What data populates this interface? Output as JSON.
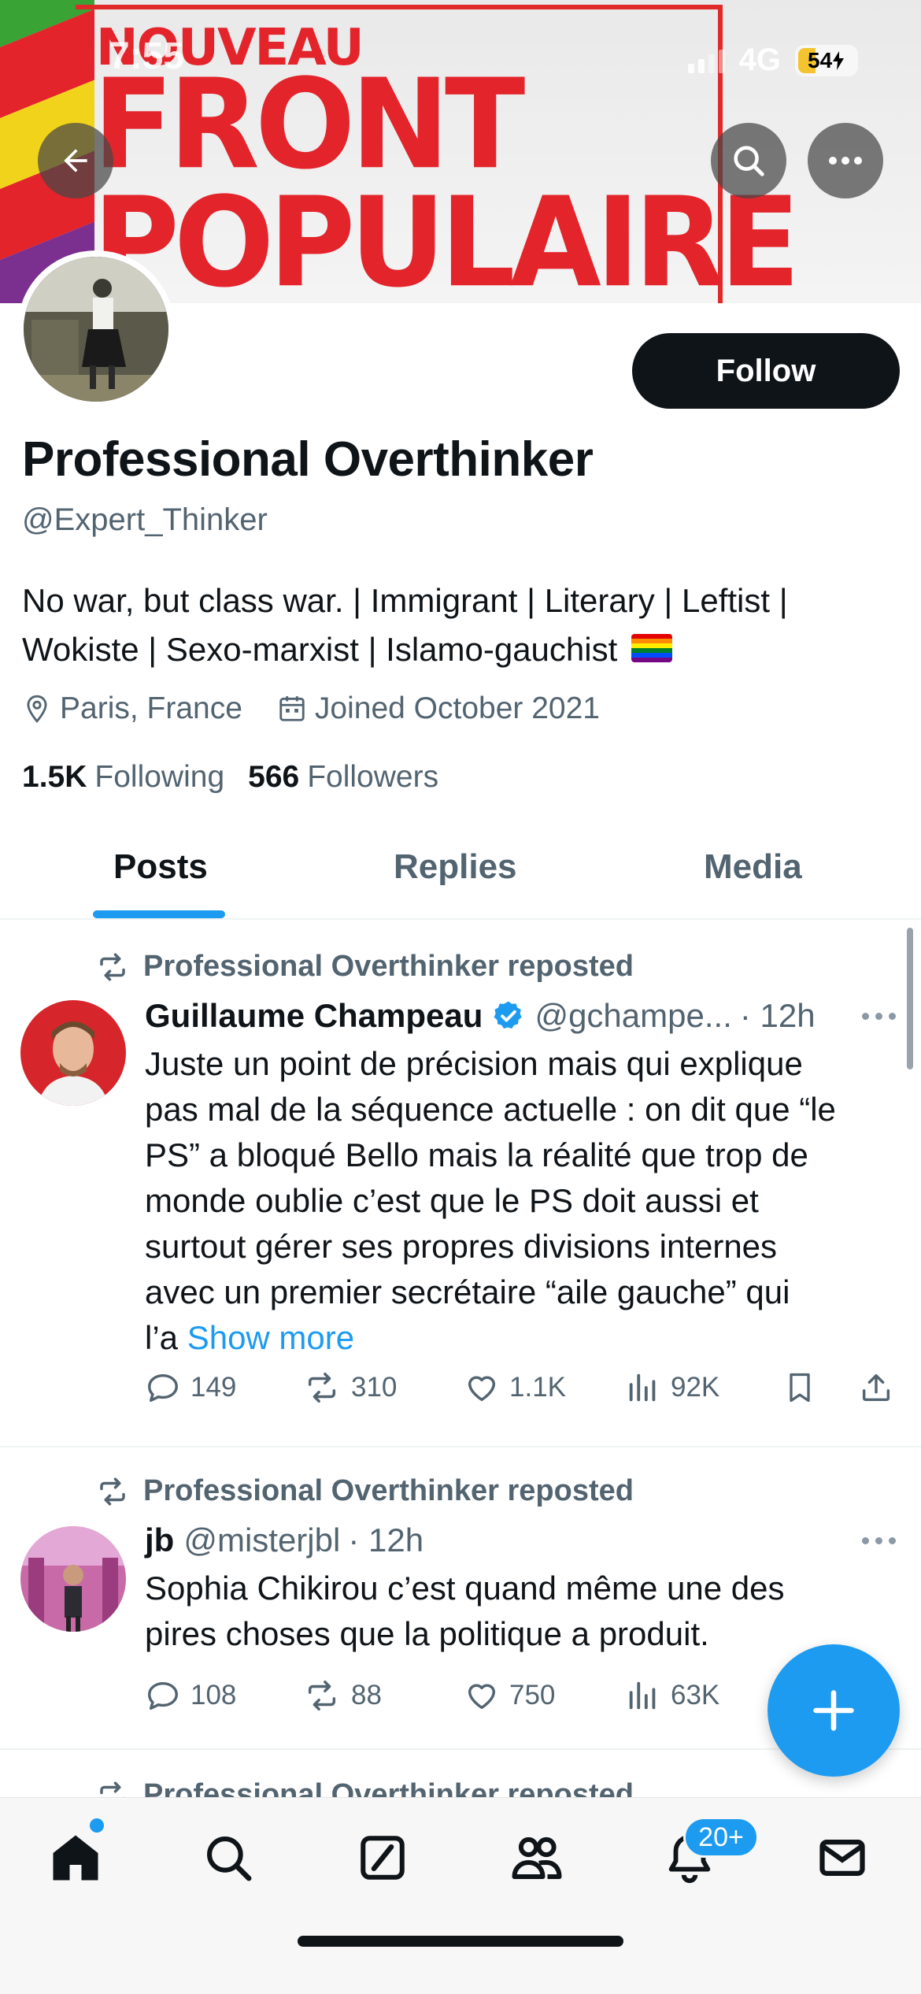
{
  "status_bar": {
    "time": "7:55",
    "network": "4G",
    "battery_level": "54"
  },
  "banner": {
    "line1": "NOUVEAU",
    "line2": "FRONT",
    "line3": "POPULAIRE"
  },
  "header_icons": [
    "back-arrow-icon",
    "search-icon",
    "more-icon"
  ],
  "profile": {
    "follow_label": "Follow",
    "name": "Professional Overthinker",
    "handle": "@Expert_Thinker",
    "bio_line1": "No war, but class war. | Immigrant | Literary | Leftist |",
    "bio_line2": "Wokiste | Sexo-marxist | Islamo-gauchist",
    "location": "Paris, France",
    "joined": "Joined October 2021",
    "following_count": "1.5K",
    "following_label": "Following",
    "followers_count": "566",
    "followers_label": "Followers"
  },
  "tabs": [
    {
      "label": "Posts",
      "active": true
    },
    {
      "label": "Replies",
      "active": false
    },
    {
      "label": "Media",
      "active": false
    }
  ],
  "posts": [
    {
      "repost_label": "Professional Overthinker reposted",
      "author": "Guillaume Champeau",
      "verified": true,
      "handle": "@gchampe...",
      "time": "· 12h",
      "text_lines": [
        "Juste un point de précision mais qui explique",
        "pas mal de la séquence actuelle : on dit que “le",
        "PS” a bloqué Bello mais la réalité que trop de",
        "monde oublie c’est que le PS doit aussi et",
        "surtout gérer ses propres divisions internes",
        "avec un premier secrétaire “aile gauche” qui"
      ],
      "last_line_prefix": "l’a",
      "show_more": "Show more",
      "replies": "149",
      "reposts": "310",
      "likes": "1.1K",
      "views": "92K"
    },
    {
      "repost_label": "Professional Overthinker reposted",
      "author": "jb",
      "verified": false,
      "handle": "@misterjbl",
      "time": "· 12h",
      "text_lines": [
        "Sophia Chikirou c’est quand même une des",
        "pires choses que la politique a produit."
      ],
      "replies": "108",
      "reposts": "88",
      "likes": "750",
      "views": "63K"
    },
    {
      "repost_label": "Professional Overthinker reposted"
    }
  ],
  "bottom_nav": {
    "items": [
      "home-icon",
      "search-icon",
      "grok-icon",
      "communities-icon",
      "notifications-icon",
      "messages-icon"
    ],
    "notification_badge": "20+"
  },
  "colors": {
    "accent": "#1d9bf0",
    "text": "#0f1419",
    "secondary": "#536471",
    "banner_red": "#e3242b"
  }
}
